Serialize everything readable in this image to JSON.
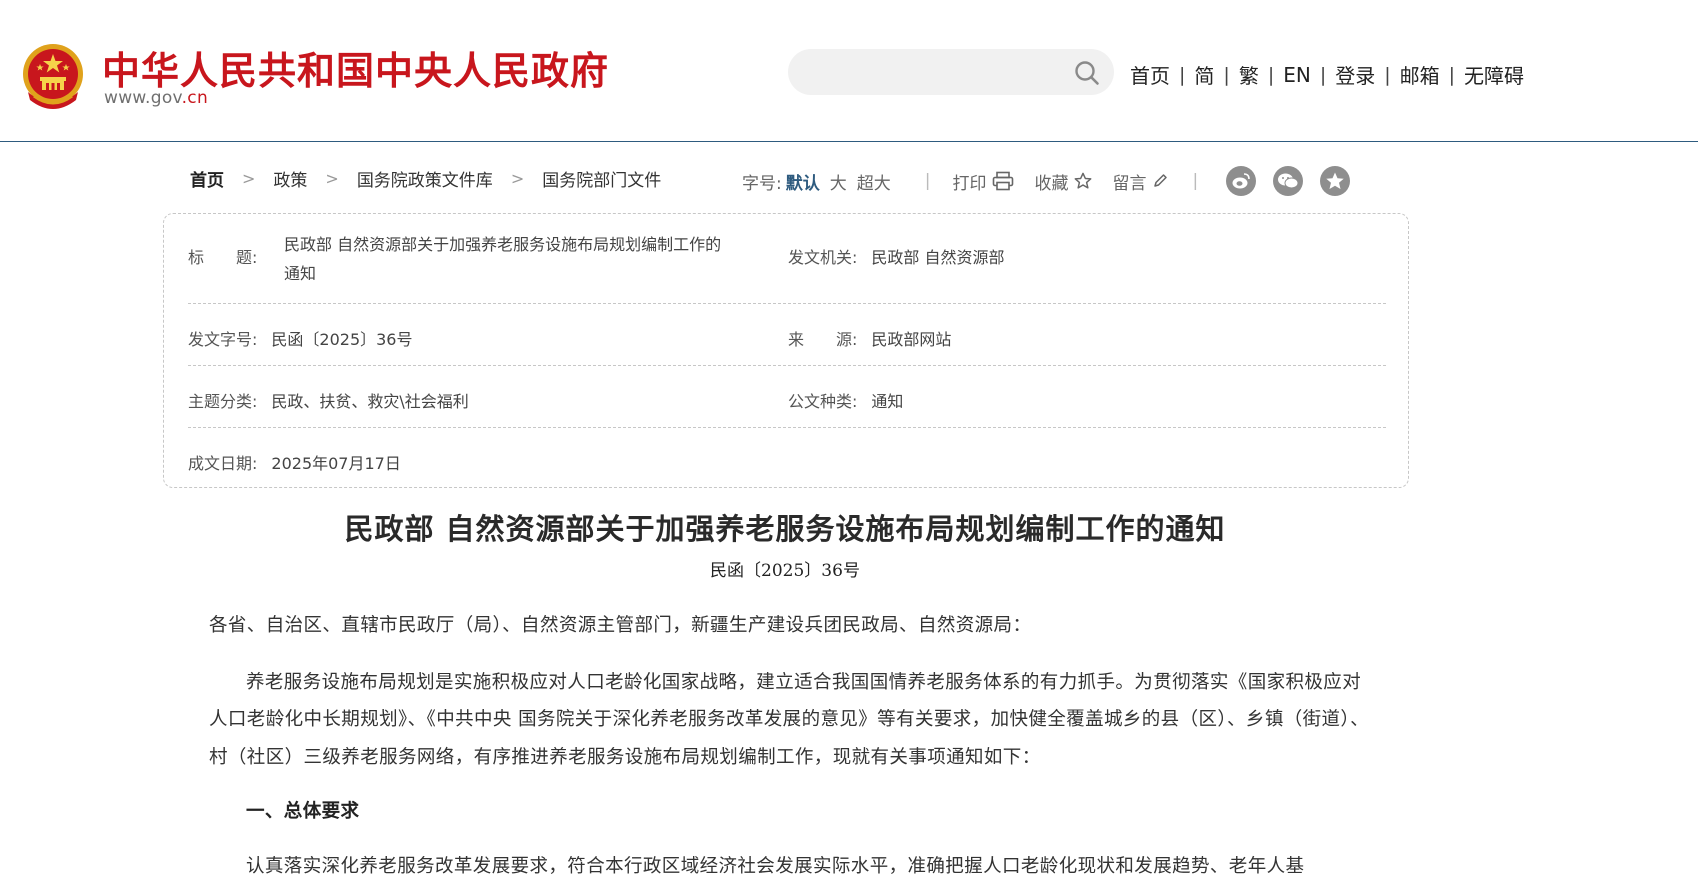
{
  "header": {
    "site_title": "中华人民共和国中央人民政府",
    "domain_main": "www.gov",
    "domain_suffix": ".cn",
    "search_placeholder": "",
    "nav": [
      "首页",
      "简",
      "繁",
      "EN",
      "登录",
      "邮箱",
      "无障碍"
    ],
    "nav_separator": "|"
  },
  "breadcrumb": [
    "首页",
    "政策",
    "国务院政策文件库",
    "国务院部门文件"
  ],
  "breadcrumb_arrow": ">",
  "tools": {
    "font_size_label": "字号:",
    "font_sizes": [
      "默认",
      "大",
      "超大"
    ],
    "print_label": "打印",
    "favorite_label": "收藏",
    "comment_label": "留言",
    "separator": "|"
  },
  "share_icons": [
    "weibo-icon",
    "wechat-icon",
    "qzone-icon"
  ],
  "info": {
    "title_label": "标　　题:",
    "title_line1": "民政部 自然资源部关于加强养老服务设施布局规划编制工作的",
    "title_line2": "通知",
    "issuer_label": "发文机关:",
    "issuer_value": "民政部 自然资源部",
    "docno_label": "发文字号:",
    "docno_value": "民函〔2025〕36号",
    "source_label": "来　　源:",
    "source_value": "民政部网站",
    "topic_label": "主题分类:",
    "topic_value": "民政、扶贫、救灾\\社会福利",
    "type_label": "公文种类:",
    "type_value": "通知",
    "date_label": "成文日期:",
    "date_value": "2025年07月17日"
  },
  "article": {
    "title": "民政部 自然资源部关于加强养老服务设施布局规划编制工作的通知",
    "docno": "民函〔2025〕36号",
    "greeting": "各省、自治区、直辖市民政厅（局）、自然资源主管部门，新疆生产建设兵团民政局、自然资源局：",
    "para1": "养老服务设施布局规划是实施积极应对人口老龄化国家战略，建立适合我国国情养老服务体系的有力抓手。为贯彻落实《国家积极应对人口老龄化中长期规划》、《中共中央 国务院关于深化养老服务改革发展的意见》等有关要求，加快健全覆盖城乡的县（区）、乡镇（街道）、村（社区）三级养老服务网络，有序推进养老服务设施布局规划编制工作，现就有关事项通知如下：",
    "heading1": "一、总体要求",
    "para2": "认真落实深化养老服务改革发展要求，符合本行政区域经济社会发展实际水平，准确把握人口老龄化现状和发展趋势、老年人基"
  },
  "colors": {
    "brand_red": "#c8161d",
    "accent_blue": "#2e5b7f",
    "share_gray": "#8e8e8e"
  }
}
